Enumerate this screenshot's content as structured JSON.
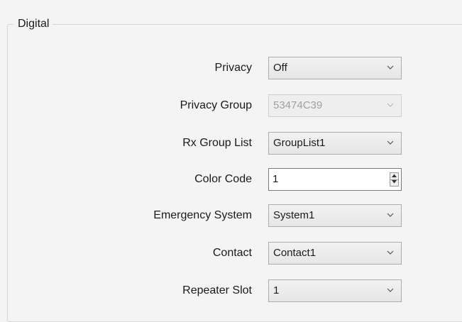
{
  "group": {
    "title": "Digital"
  },
  "fields": [
    {
      "label": "Privacy",
      "value": "Off"
    },
    {
      "label": "Privacy Group",
      "value": "53474C39"
    },
    {
      "label": "Rx Group List",
      "value": "GroupList1"
    },
    {
      "label": "Color Code",
      "value": "1"
    },
    {
      "label": "Emergency System",
      "value": "System1"
    },
    {
      "label": "Contact",
      "value": "Contact1"
    },
    {
      "label": "Repeater Slot",
      "value": "1"
    }
  ],
  "icons": {
    "dropdown": "chevron-down-icon",
    "spinner_up": "arrow-up-icon",
    "spinner_down": "arrow-down-icon"
  }
}
